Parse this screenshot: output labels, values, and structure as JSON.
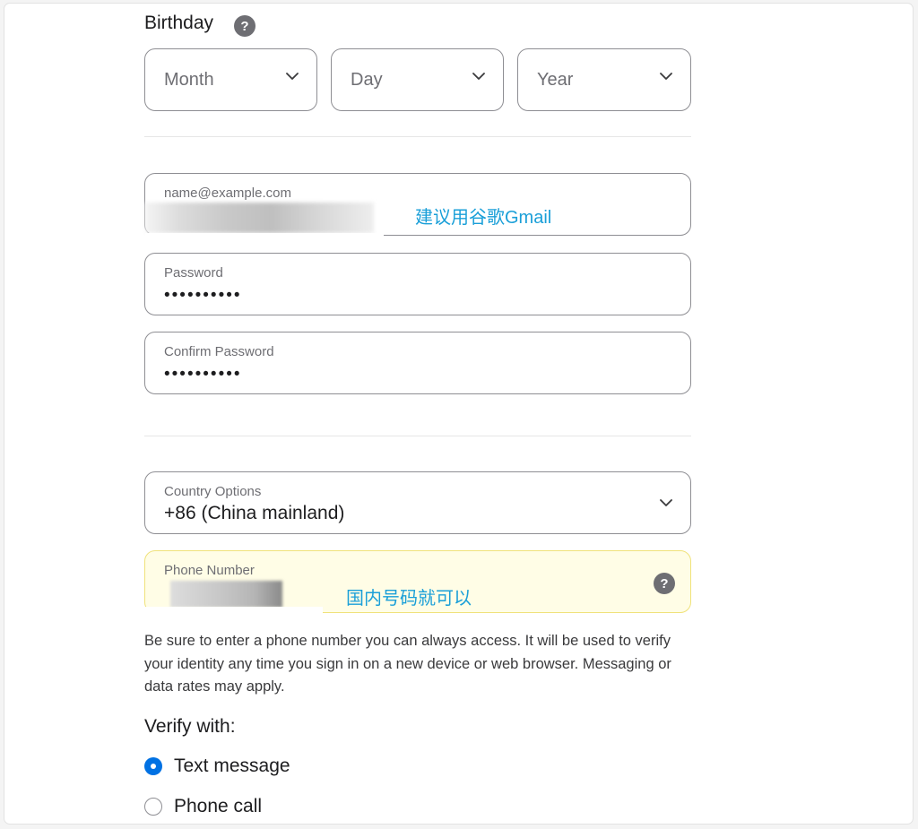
{
  "birthday": {
    "title": "Birthday",
    "help_glyph": "?",
    "month_placeholder": "Month",
    "day_placeholder": "Day",
    "year_placeholder": "Year"
  },
  "email": {
    "placeholder": "name@example.com",
    "annotation": "建议用谷歌Gmail"
  },
  "password": {
    "label": "Password",
    "value": "••••••••••"
  },
  "confirm_password": {
    "label": "Confirm Password",
    "value": "••••••••••"
  },
  "country": {
    "label": "Country Options",
    "value": "+86 (China mainland)"
  },
  "phone": {
    "label": "Phone Number",
    "annotation": "国内号码就可以",
    "help_glyph": "?",
    "highlight_border": "#f0e27a",
    "highlight_bg": "#fffde6"
  },
  "helper_text": "Be sure to enter a phone number you can always access. It will be used to verify your identity any time you sign in on a new device or web browser. Messaging or data rates may apply.",
  "verify": {
    "title": "Verify with:",
    "options": [
      {
        "label": "Text message",
        "checked": true
      },
      {
        "label": "Phone call",
        "checked": false
      }
    ]
  },
  "colors": {
    "accent": "#0071e3",
    "annotation": "#1a9fd8",
    "border": "#8e8e93"
  }
}
